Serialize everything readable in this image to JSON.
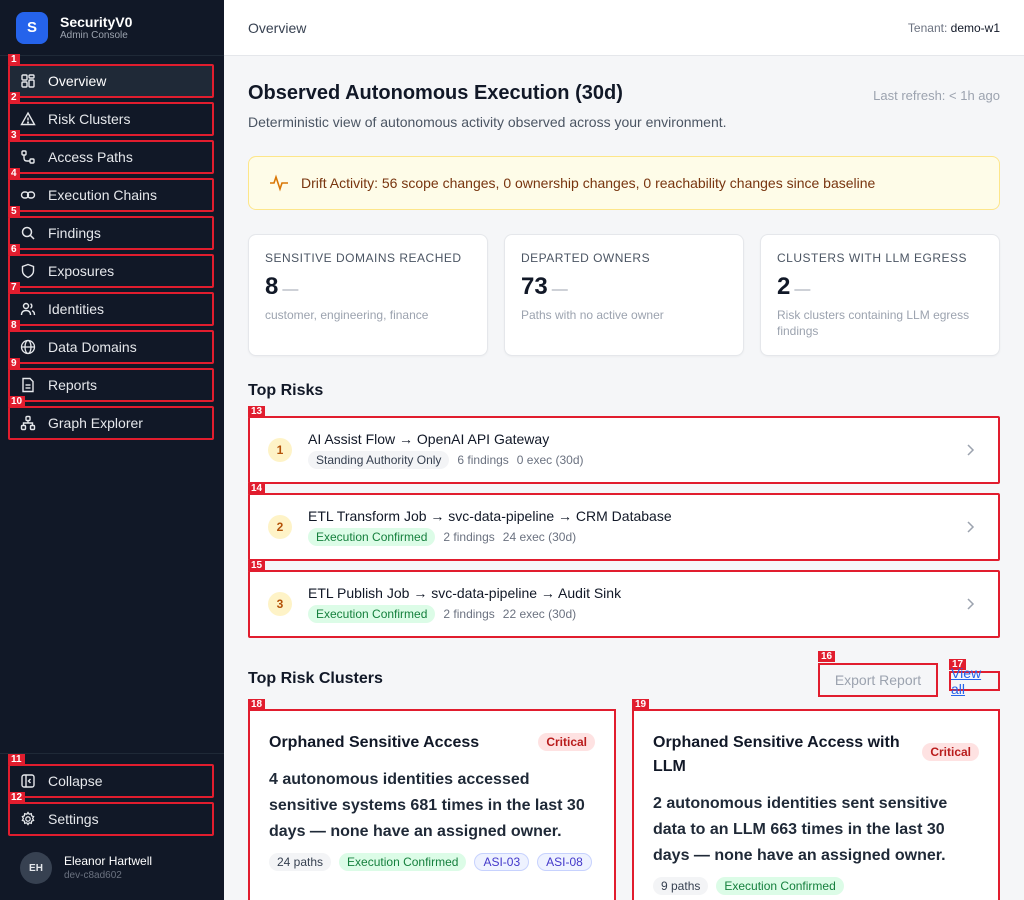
{
  "brand": {
    "logo_letter": "S",
    "name": "SecurityV0",
    "subtitle": "Admin Console"
  },
  "sidebar": {
    "items": [
      {
        "tag": "1",
        "label": "Overview",
        "icon": "grid-icon",
        "active": true
      },
      {
        "tag": "2",
        "label": "Risk Clusters",
        "icon": "warning-icon"
      },
      {
        "tag": "3",
        "label": "Access Paths",
        "icon": "route-icon"
      },
      {
        "tag": "4",
        "label": "Execution Chains",
        "icon": "link-icon"
      },
      {
        "tag": "5",
        "label": "Findings",
        "icon": "search-icon"
      },
      {
        "tag": "6",
        "label": "Exposures",
        "icon": "shield-icon"
      },
      {
        "tag": "7",
        "label": "Identities",
        "icon": "users-icon"
      },
      {
        "tag": "8",
        "label": "Data Domains",
        "icon": "globe-icon"
      },
      {
        "tag": "9",
        "label": "Reports",
        "icon": "document-icon"
      },
      {
        "tag": "10",
        "label": "Graph Explorer",
        "icon": "graph-icon"
      }
    ],
    "bottom": [
      {
        "tag": "11",
        "label": "Collapse",
        "icon": "collapse-icon"
      },
      {
        "tag": "12",
        "label": "Settings",
        "icon": "gear-icon"
      }
    ],
    "user": {
      "initials": "EH",
      "name": "Eleanor Hartwell",
      "id": "dev-c8ad602"
    }
  },
  "topbar": {
    "title": "Overview",
    "tenant_label": "Tenant:",
    "tenant_value": "demo-w1"
  },
  "header": {
    "title": "Observed Autonomous Execution (30d)",
    "refresh": "Last refresh: < 1h ago",
    "subtitle": "Deterministic view of autonomous activity observed across your environment."
  },
  "drift": {
    "text": "Drift Activity: 56 scope changes, 0 ownership changes, 0 reachability changes since baseline"
  },
  "stats": [
    {
      "label": "SENSITIVE DOMAINS REACHED",
      "value": "8",
      "dash": "—",
      "desc": "customer, engineering, finance"
    },
    {
      "label": "DEPARTED OWNERS",
      "value": "73",
      "dash": "—",
      "desc": "Paths with no active owner"
    },
    {
      "label": "CLUSTERS WITH LLM EGRESS",
      "value": "2",
      "dash": "—",
      "desc": "Risk clusters containing LLM egress findings"
    }
  ],
  "top_risks": {
    "title": "Top Risks",
    "items": [
      {
        "tag": "13",
        "rank": "1",
        "title": "AI Assist Flow → OpenAI API Gateway",
        "pill": "Standing Authority Only",
        "pill_kind": "gray",
        "findings": "6 findings",
        "exec": "0 exec (30d)"
      },
      {
        "tag": "14",
        "rank": "2",
        "title": "ETL Transform Job → svc-data-pipeline → CRM Database",
        "pill": "Execution Confirmed",
        "pill_kind": "green",
        "findings": "2 findings",
        "exec": "24 exec (30d)"
      },
      {
        "tag": "15",
        "rank": "3",
        "title": "ETL Publish Job → svc-data-pipeline → Audit Sink",
        "pill": "Execution Confirmed",
        "pill_kind": "green",
        "findings": "2 findings",
        "exec": "22 exec (30d)"
      }
    ]
  },
  "clusters": {
    "title": "Top Risk Clusters",
    "export_tag": "16",
    "export_label": "Export Report",
    "viewall_tag": "17",
    "viewall_label": "View all",
    "items": [
      {
        "tag": "18",
        "title": "Orphaned Sensitive Access",
        "severity": "Critical",
        "desc": "4 autonomous identities accessed sensitive systems 681 times in the last 30 days — none have an assigned owner.",
        "paths": "24 paths",
        "status": "Execution Confirmed",
        "asi": [
          "ASI-03",
          "ASI-08"
        ]
      },
      {
        "tag": "19",
        "title": "Orphaned Sensitive Access with LLM",
        "severity": "Critical",
        "desc": "2 autonomous identities sent sensitive data to an LLM 663 times in the last 30 days — none have an assigned owner.",
        "paths": "9 paths",
        "status": "Execution Confirmed",
        "asi": []
      }
    ]
  },
  "colors": {
    "sidebar_bg": "#111827",
    "accent": "#2563eb",
    "annotation": "#e11d2e",
    "critical": "#b91c1c",
    "confirmed": "#15803d"
  }
}
